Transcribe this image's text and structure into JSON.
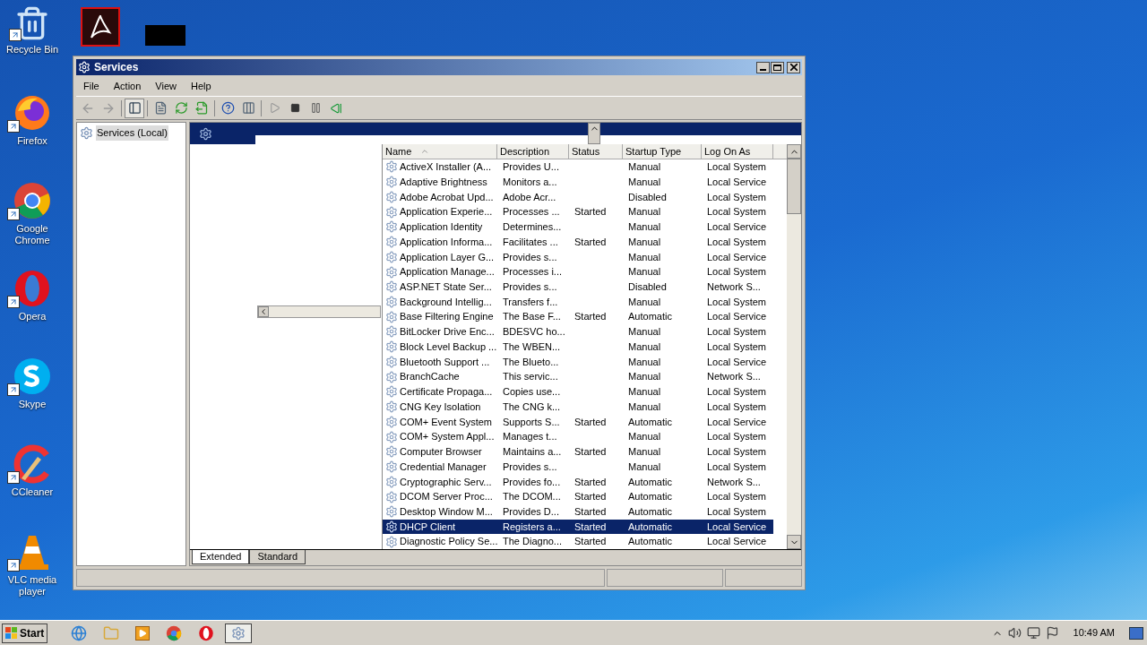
{
  "desktop_icons": [
    {
      "label": "Recycle Bin",
      "kind": "bin"
    },
    {
      "label": "Firefox",
      "kind": "firefox"
    },
    {
      "label": "Google Chrome",
      "kind": "chrome"
    },
    {
      "label": "Opera",
      "kind": "opera"
    },
    {
      "label": "Skype",
      "kind": "skype"
    },
    {
      "label": "CCleaner",
      "kind": "ccleaner"
    },
    {
      "label": "VLC media player",
      "kind": "vlc"
    }
  ],
  "window": {
    "title": "Services"
  },
  "menu": [
    "File",
    "Action",
    "View",
    "Help"
  ],
  "tree": [
    {
      "label": "Services (Local)",
      "selected": true
    }
  ],
  "table": {
    "columns": [
      {
        "label": "Name",
        "sorted": true
      },
      {
        "label": "Description",
        "sorted": false
      },
      {
        "label": "Status",
        "sorted": false
      },
      {
        "label": "Startup Type",
        "sorted": false
      },
      {
        "label": "Log On As",
        "sorted": false
      }
    ],
    "rows": [
      {
        "name": "ActiveX Installer (A...",
        "description": "Provides U...",
        "status": "",
        "startup_type": "Manual",
        "log_on_as": "Local System",
        "selected": false
      },
      {
        "name": "Adaptive Brightness",
        "description": "Monitors a...",
        "status": "",
        "startup_type": "Manual",
        "log_on_as": "Local Service",
        "selected": false
      },
      {
        "name": "Adobe Acrobat Upd...",
        "description": "Adobe Acr...",
        "status": "",
        "startup_type": "Disabled",
        "log_on_as": "Local System",
        "selected": false
      },
      {
        "name": "Application Experie...",
        "description": "Processes ...",
        "status": "Started",
        "startup_type": "Manual",
        "log_on_as": "Local System",
        "selected": false
      },
      {
        "name": "Application Identity",
        "description": "Determines...",
        "status": "",
        "startup_type": "Manual",
        "log_on_as": "Local Service",
        "selected": false
      },
      {
        "name": "Application Informa...",
        "description": "Facilitates ...",
        "status": "Started",
        "startup_type": "Manual",
        "log_on_as": "Local System",
        "selected": false
      },
      {
        "name": "Application Layer G...",
        "description": "Provides s...",
        "status": "",
        "startup_type": "Manual",
        "log_on_as": "Local Service",
        "selected": false
      },
      {
        "name": "Application Manage...",
        "description": "Processes i...",
        "status": "",
        "startup_type": "Manual",
        "log_on_as": "Local System",
        "selected": false
      },
      {
        "name": "ASP.NET State Ser...",
        "description": "Provides s...",
        "status": "",
        "startup_type": "Disabled",
        "log_on_as": "Network S...",
        "selected": false
      },
      {
        "name": "Background Intellig...",
        "description": "Transfers f...",
        "status": "",
        "startup_type": "Manual",
        "log_on_as": "Local System",
        "selected": false
      },
      {
        "name": "Base Filtering Engine",
        "description": "The Base F...",
        "status": "Started",
        "startup_type": "Automatic",
        "log_on_as": "Local Service",
        "selected": false
      },
      {
        "name": "BitLocker Drive Enc...",
        "description": "BDESVC ho...",
        "status": "",
        "startup_type": "Manual",
        "log_on_as": "Local System",
        "selected": false
      },
      {
        "name": "Block Level Backup ...",
        "description": "The WBEN...",
        "status": "",
        "startup_type": "Manual",
        "log_on_as": "Local System",
        "selected": false
      },
      {
        "name": "Bluetooth Support ...",
        "description": "The Blueto...",
        "status": "",
        "startup_type": "Manual",
        "log_on_as": "Local Service",
        "selected": false
      },
      {
        "name": "BranchCache",
        "description": "This servic...",
        "status": "",
        "startup_type": "Manual",
        "log_on_as": "Network S...",
        "selected": false
      },
      {
        "name": "Certificate Propaga...",
        "description": "Copies use...",
        "status": "",
        "startup_type": "Manual",
        "log_on_as": "Local System",
        "selected": false
      },
      {
        "name": "CNG Key Isolation",
        "description": "The CNG k...",
        "status": "",
        "startup_type": "Manual",
        "log_on_as": "Local System",
        "selected": false
      },
      {
        "name": "COM+ Event System",
        "description": "Supports S...",
        "status": "Started",
        "startup_type": "Automatic",
        "log_on_as": "Local Service",
        "selected": false
      },
      {
        "name": "COM+ System Appl...",
        "description": "Manages t...",
        "status": "",
        "startup_type": "Manual",
        "log_on_as": "Local System",
        "selected": false
      },
      {
        "name": "Computer Browser",
        "description": "Maintains a...",
        "status": "Started",
        "startup_type": "Manual",
        "log_on_as": "Local System",
        "selected": false
      },
      {
        "name": "Credential Manager",
        "description": "Provides s...",
        "status": "",
        "startup_type": "Manual",
        "log_on_as": "Local System",
        "selected": false
      },
      {
        "name": "Cryptographic Serv...",
        "description": "Provides fo...",
        "status": "Started",
        "startup_type": "Automatic",
        "log_on_as": "Network S...",
        "selected": false
      },
      {
        "name": "DCOM Server Proc...",
        "description": "The DCOM...",
        "status": "Started",
        "startup_type": "Automatic",
        "log_on_as": "Local System",
        "selected": false
      },
      {
        "name": "Desktop Window M...",
        "description": "Provides D...",
        "status": "Started",
        "startup_type": "Automatic",
        "log_on_as": "Local System",
        "selected": false
      },
      {
        "name": "DHCP Client",
        "description": "Registers a...",
        "status": "Started",
        "startup_type": "Automatic",
        "log_on_as": "Local Service",
        "selected": true
      },
      {
        "name": "Diagnostic Policy Se...",
        "description": "The Diagno...",
        "status": "Started",
        "startup_type": "Automatic",
        "log_on_as": "Local Service",
        "selected": false
      }
    ]
  },
  "view_tabs": [
    {
      "label": "Extended",
      "selected": true
    },
    {
      "label": "Standard",
      "selected": false
    }
  ],
  "taskbar": {
    "start": "Start",
    "clock": "10:49 AM"
  }
}
